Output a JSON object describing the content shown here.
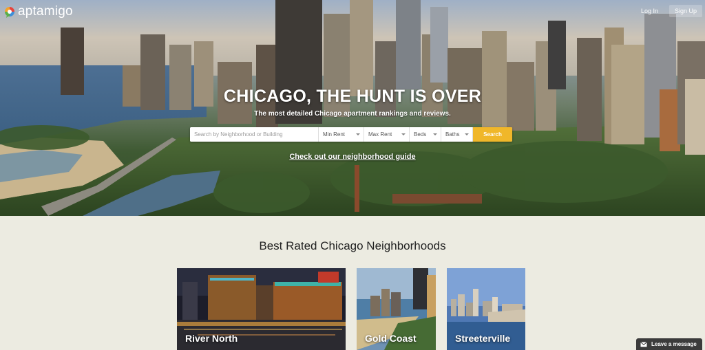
{
  "brand": {
    "name": "aptamigo",
    "logo_colors": [
      "#e8433b",
      "#f2a32c",
      "#5bb04a",
      "#3f8fd8"
    ]
  },
  "header": {
    "login_label": "Log In",
    "signup_label": "Sign Up"
  },
  "hero": {
    "headline": "CHICAGO, THE HUNT IS OVER",
    "subheadline": "The most detailed Chicago apartment rankings and reviews.",
    "guide_link": "Check out our neighborhood guide"
  },
  "search": {
    "placeholder": "Search by Neighborhood or Building",
    "min_rent": "Min Rent",
    "max_rent": "Max Rent",
    "beds": "Beds",
    "baths": "Baths",
    "button_label": "Search",
    "button_color": "#f0b72a"
  },
  "neighborhoods": {
    "title": "Best Rated Chicago Neighborhoods",
    "cards": [
      {
        "name": "River North"
      },
      {
        "name": "Gold Coast"
      },
      {
        "name": "Streeterville"
      }
    ]
  },
  "chat": {
    "label": "Leave a message"
  }
}
